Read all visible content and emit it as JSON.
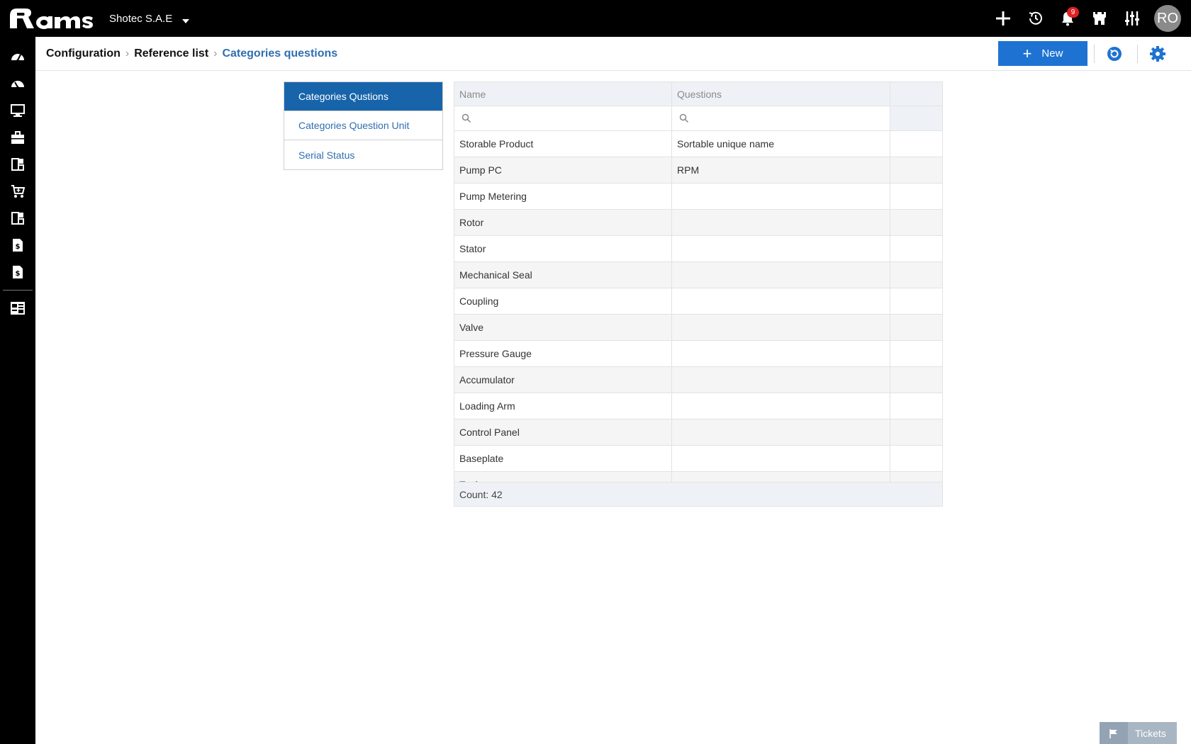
{
  "topbar": {
    "company": "Shotec S.A.E",
    "notification_count": "9",
    "avatar_initials": "RO",
    "icons": [
      "add-icon",
      "history-icon",
      "bell-icon",
      "castle-icon",
      "sliders-icon"
    ]
  },
  "sidebar": {
    "icons": [
      "dashboard-icon",
      "dashboard-alt-icon",
      "monitor-icon",
      "briefcase-icon",
      "modules-icon",
      "cart-icon",
      "modules-alt-icon",
      "invoice-icon",
      "invoice-alt-icon",
      "config-icon"
    ]
  },
  "breadcrumb": {
    "items": [
      "Configuration",
      "Reference list"
    ],
    "current": "Categories questions"
  },
  "toolbar": {
    "new_label": "New"
  },
  "ref_list": {
    "items": [
      {
        "label": "Categories Qustions",
        "active": true
      },
      {
        "label": "Categories Question Unit",
        "active": false
      },
      {
        "label": "Serial Status",
        "active": false
      }
    ]
  },
  "grid": {
    "columns": [
      "Name",
      "Questions",
      ""
    ],
    "rows": [
      {
        "name": "Storable Product",
        "questions": "Sortable unique name"
      },
      {
        "name": "Pump PC",
        "questions": "RPM"
      },
      {
        "name": "Pump Metering",
        "questions": ""
      },
      {
        "name": "Rotor",
        "questions": ""
      },
      {
        "name": "Stator",
        "questions": ""
      },
      {
        "name": "Mechanical Seal",
        "questions": ""
      },
      {
        "name": "Coupling",
        "questions": ""
      },
      {
        "name": "Valve",
        "questions": ""
      },
      {
        "name": "Pressure Gauge",
        "questions": ""
      },
      {
        "name": "Accumulator",
        "questions": ""
      },
      {
        "name": "Loading Arm",
        "questions": ""
      },
      {
        "name": "Control Panel",
        "questions": ""
      },
      {
        "name": "Baseplate",
        "questions": ""
      },
      {
        "name": "Tank",
        "questions": ""
      }
    ],
    "footer": "Count: 42"
  },
  "tickets": {
    "label": "Tickets"
  },
  "colors": {
    "accent": "#1e73d2",
    "active_item": "#1864ab",
    "link": "#2f6fb0",
    "topbar": "#000000",
    "grid_header": "#eef2f7"
  }
}
